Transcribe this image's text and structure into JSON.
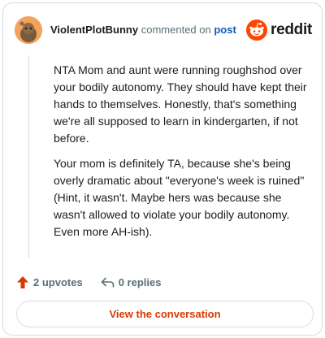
{
  "comment": {
    "username": "ViolentPlotBunny",
    "action_text": "commented on",
    "post_link": "post",
    "brand": "reddit",
    "paragraphs": [
      "NTA Mom and aunt were running roughshod over your bodily autonomy. They should have kept their hands to themselves. Honestly, that's something we're all supposed to learn in kindergarten, if not before.",
      "Your mom is definitely TA, because she's being overly dramatic about \"everyone's week is ruined\" (Hint, it wasn't. Maybe hers was because she wasn't allowed to violate your bodily autonomy. Even more AH-ish)."
    ],
    "upvotes": "2 upvotes",
    "replies": "0 replies",
    "view_button": "View the conversation"
  },
  "colors": {
    "upvote": "#d93a00",
    "brand_orange": "#ff4500",
    "link": "#0a5cbd"
  },
  "icons": [
    "avatar",
    "reddit-snoo-icon",
    "upvote-arrow-icon",
    "reply-arrow-icon"
  ]
}
